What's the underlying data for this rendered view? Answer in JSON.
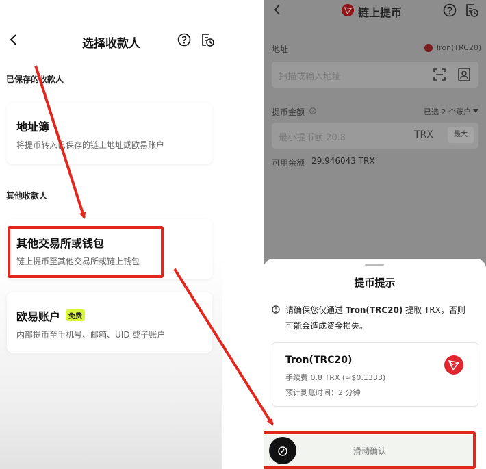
{
  "left": {
    "header": {
      "title": "选择收款人"
    },
    "saved_section_label": "已保存的收款人",
    "address_book": {
      "title": "地址簿",
      "subtitle": "将提币转入已保存的链上地址或欧易账户"
    },
    "other_section_label": "其他收款人",
    "other_exchange": {
      "title": "其他交易所或钱包",
      "subtitle": "链上提币至其他交易所或链上钱包"
    },
    "okx_account": {
      "title": "欧易账户",
      "badge": "免费",
      "subtitle": "内部提币至手机号、邮箱、UID 或子账户"
    }
  },
  "right": {
    "header": {
      "title": "链上提币"
    },
    "address_label": "地址",
    "network_value": "Tron(TRC20)",
    "address_placeholder": "扫描或输入地址",
    "amount_label": "提币金额",
    "accounts_selected": "已选 2 个账户",
    "amount_placeholder": "最小提币额 20.8",
    "currency": "TRX",
    "max_button": "最大",
    "available_label": "可用余额",
    "available_value": "29.946043 TRX",
    "sheet": {
      "title": "提币提示",
      "warning_part1": "请确保您仅通过",
      "warning_bold": "Tron(TRC20)",
      "warning_part2": "提取 TRX，否则",
      "warning_line2": "可能会造成资金损失。",
      "network_name": "Tron(TRC20)",
      "fee_text": "手续费 0.8 TRX (≈$0.1333)",
      "eta_text": "预计到账时间：2 分钟",
      "slider_label": "滑动确认"
    }
  },
  "colors": {
    "highlight": "#e2271f",
    "tron_red": "#e0262f",
    "badge_green": "#d9f53e"
  }
}
